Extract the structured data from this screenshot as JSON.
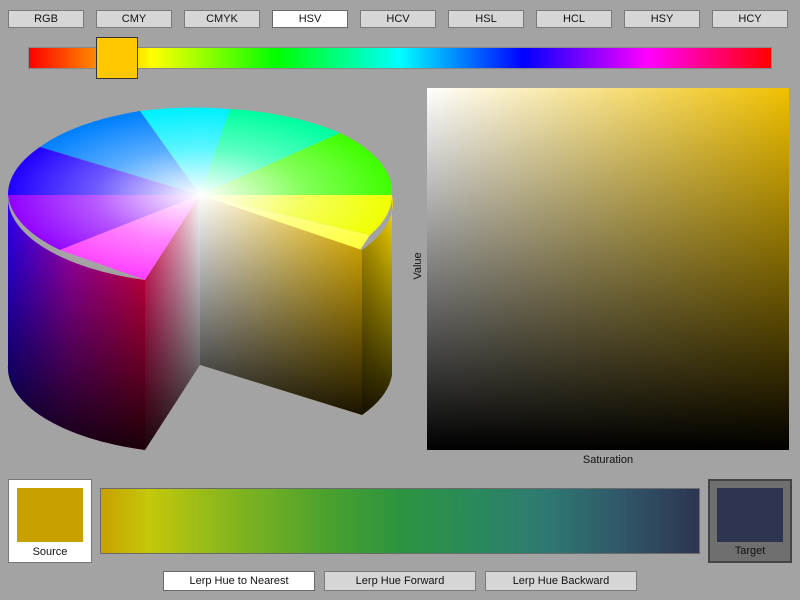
{
  "tabs": [
    {
      "label": "RGB",
      "active": false
    },
    {
      "label": "CMY",
      "active": false
    },
    {
      "label": "CMYK",
      "active": false
    },
    {
      "label": "HSV",
      "active": true
    },
    {
      "label": "HCV",
      "active": false
    },
    {
      "label": "HSL",
      "active": false
    },
    {
      "label": "HCL",
      "active": false
    },
    {
      "label": "HSY",
      "active": false
    },
    {
      "label": "HCY",
      "active": false
    }
  ],
  "hue_slider": {
    "value_fraction": 0.12,
    "handle_color": "#ffc800"
  },
  "plane": {
    "y_axis_label": "Value",
    "x_axis_label": "Saturation",
    "hue_color": "#f0c000"
  },
  "source": {
    "label": "Source",
    "color": "#c8a000"
  },
  "target": {
    "label": "Target",
    "color": "#2e3550"
  },
  "lerp_buttons": [
    {
      "label": "Lerp Hue to Nearest",
      "active": true
    },
    {
      "label": "Lerp Hue Forward",
      "active": false
    },
    {
      "label": "Lerp Hue Backward",
      "active": false
    }
  ]
}
